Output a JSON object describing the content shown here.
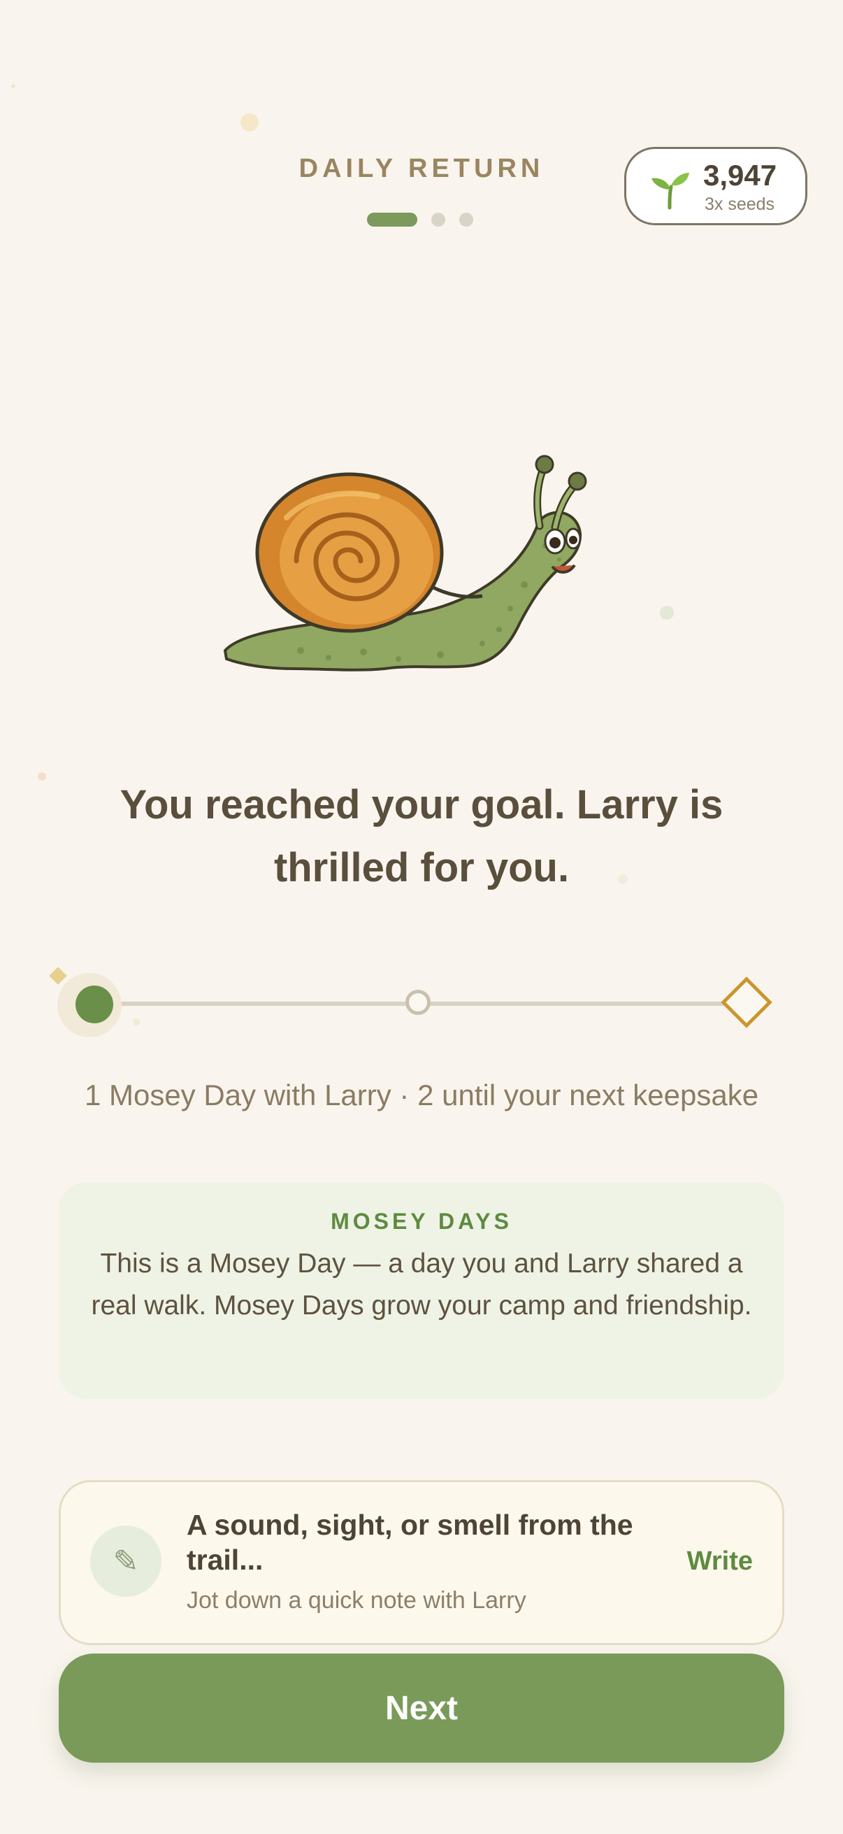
{
  "header": {
    "title": "DAILY RETURN",
    "pages": 3,
    "active_page": 1
  },
  "seeds": {
    "count": "3,947",
    "multiplier": "3x seeds",
    "icon": "sprout-icon"
  },
  "hero": {
    "icon": "snail-illustration"
  },
  "headline": "You reached your goal. Larry is thrilled for you.",
  "progress": {
    "current_step": 1,
    "total_steps": 3,
    "goal_icon": "diamond-icon"
  },
  "mosey_summary": "1 Mosey Day with Larry · 2 until your next keepsake",
  "info_card": {
    "title": "MOSEY DAYS",
    "body": "This is a Mosey Day — a day you and Larry shared a real walk. Mosey Days grow your camp and friendship."
  },
  "journal": {
    "icon": "pencil-icon",
    "prompt": "A sound, sight, or smell from the trail...",
    "subtitle": "Jot down a quick note with Larry",
    "action": "Write"
  },
  "next_button": "Next",
  "colors": {
    "accent": "#7a9a5a",
    "background": "#f9f5ee",
    "goal": "#c9962f",
    "title": "#9a8560"
  }
}
